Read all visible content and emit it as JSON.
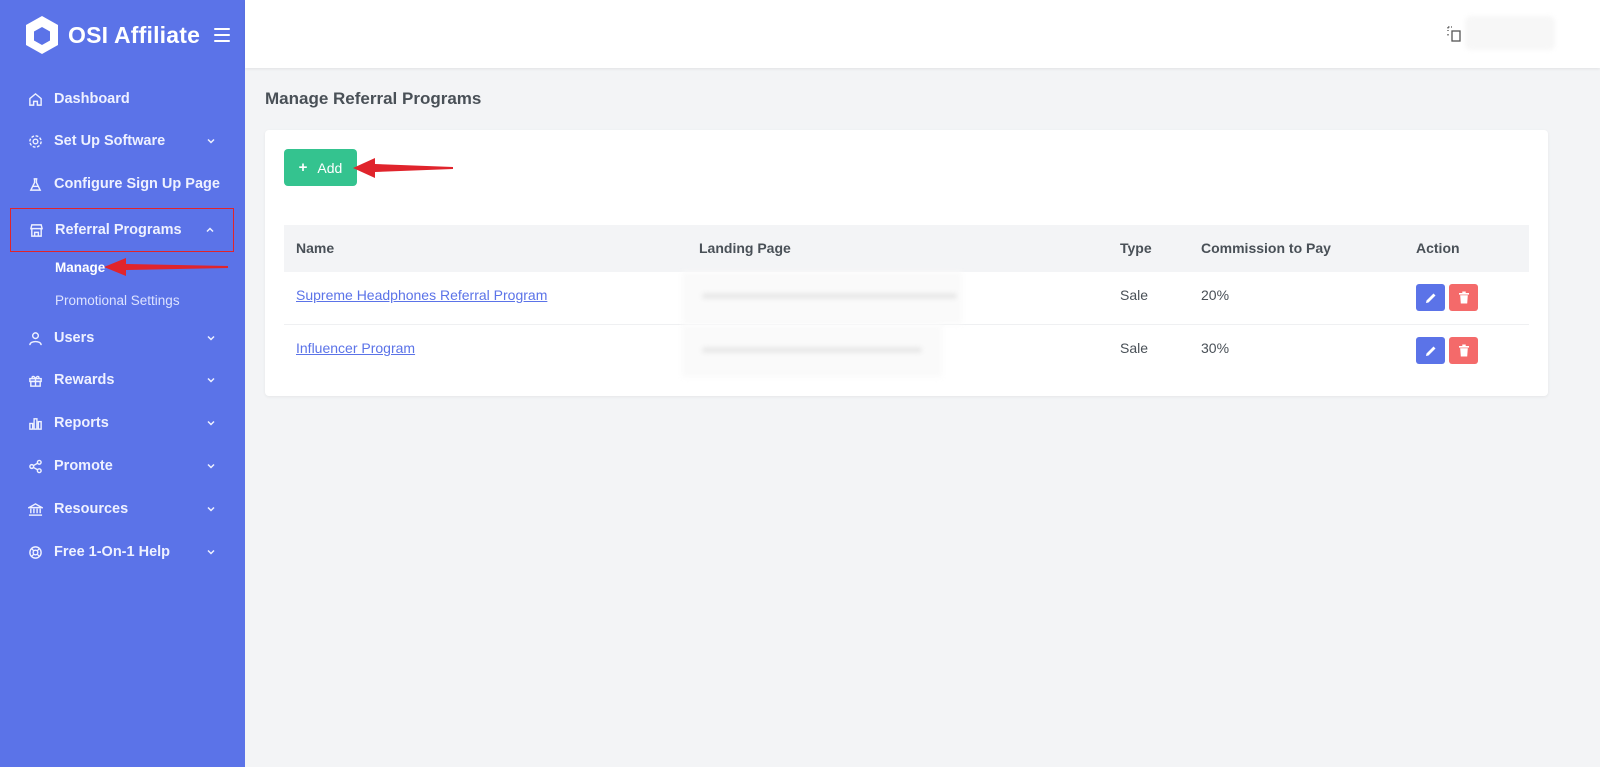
{
  "brand": {
    "name": "OSI Affiliate"
  },
  "sidebar": {
    "items": [
      {
        "label": "Dashboard",
        "icon": "home-icon"
      },
      {
        "label": "Set Up Software",
        "icon": "gear-icon"
      },
      {
        "label": "Configure Sign Up Page",
        "icon": "flask-icon"
      },
      {
        "label": "Referral Programs",
        "icon": "store-icon"
      },
      {
        "label": "Users",
        "icon": "user-icon"
      },
      {
        "label": "Rewards",
        "icon": "gift-icon"
      },
      {
        "label": "Reports",
        "icon": "bar-chart-icon"
      },
      {
        "label": "Promote",
        "icon": "share-icon"
      },
      {
        "label": "Resources",
        "icon": "bank-icon"
      },
      {
        "label": "Free 1-On-1 Help",
        "icon": "lifebuoy-icon"
      }
    ],
    "sub_items": [
      {
        "label": "Manage"
      },
      {
        "label": "Promotional Settings"
      }
    ]
  },
  "page": {
    "title": "Manage Referral Programs"
  },
  "toolbar": {
    "add_label": "Add"
  },
  "table": {
    "columns": [
      "Name",
      "Landing Page",
      "Type",
      "Commission to Pay",
      "Action"
    ],
    "rows": [
      {
        "name": "Supreme Headphones Referral Program",
        "type": "Sale",
        "commission": "20%"
      },
      {
        "name": "Influencer Program",
        "type": "Sale",
        "commission": "30%"
      }
    ]
  },
  "colors": {
    "sidebar": "#5b73e8",
    "add_button": "#34c38f",
    "edit_button": "#5b73e8",
    "delete_button": "#f46a6a",
    "annotation": "#e0242c"
  }
}
